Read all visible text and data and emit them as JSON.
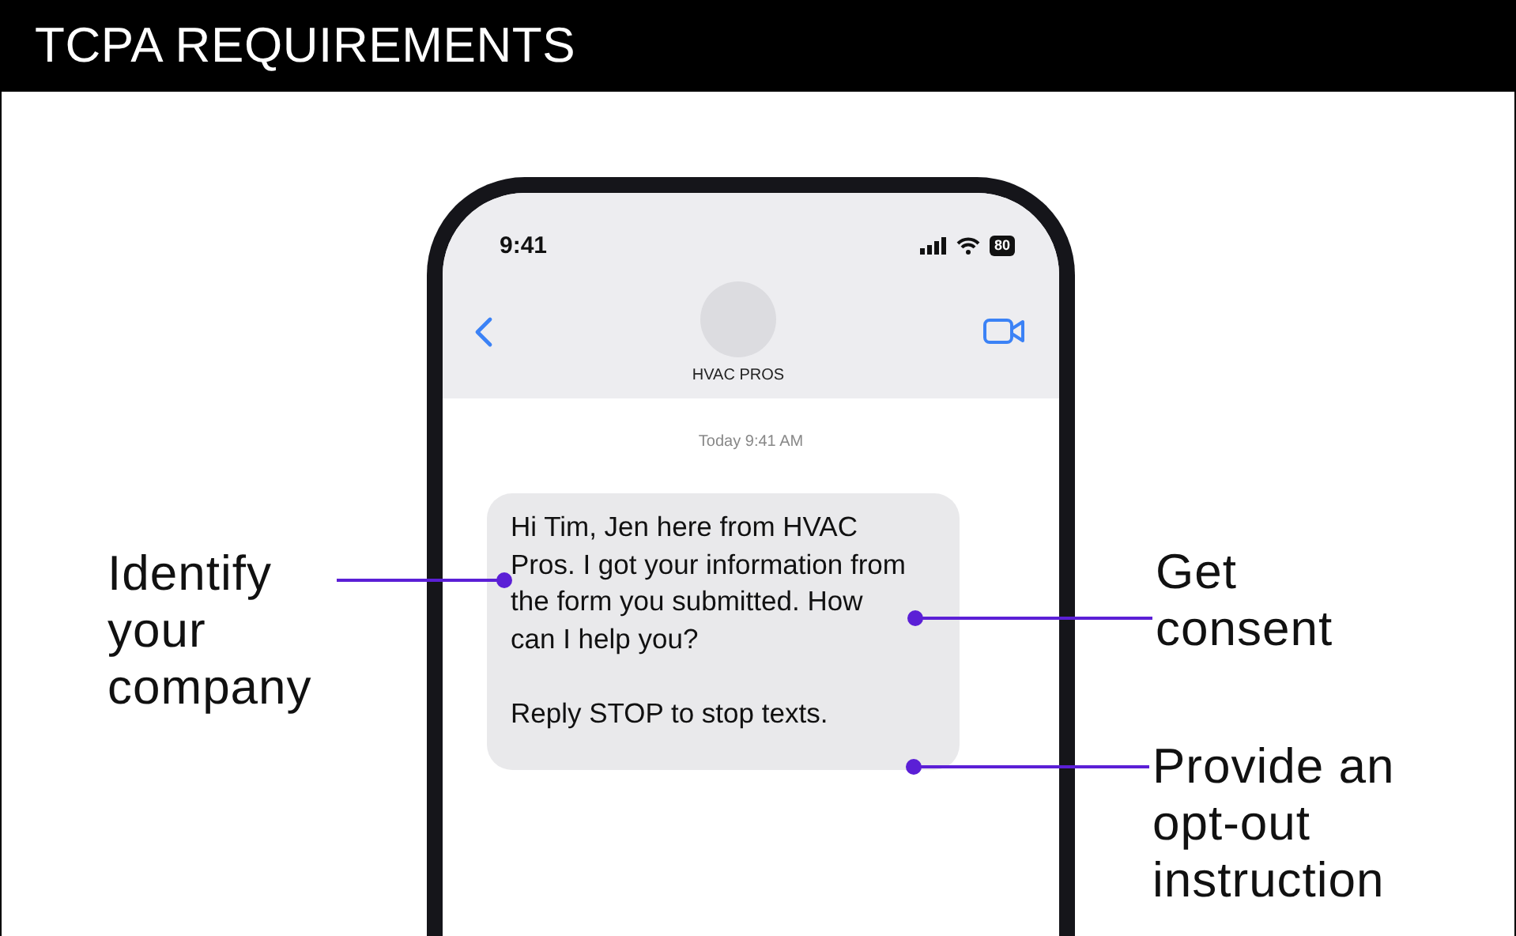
{
  "header": {
    "title": "TCPA REQUIREMENTS"
  },
  "phone": {
    "status_bar": {
      "time": "9:41",
      "battery": "80"
    },
    "contact": {
      "name": "HVAC PROS"
    },
    "timestamp": "Today 9:41 AM",
    "message": {
      "paragraphs": [
        "Hi Tim, Jen here from HVAC Pros. I got your information from the form you submitted. How can I help you?",
        "Reply STOP to stop texts."
      ]
    }
  },
  "callouts": [
    {
      "text": "Identify your company"
    },
    {
      "text": "Get consent"
    },
    {
      "text": "Provide an opt-out instruction"
    }
  ]
}
